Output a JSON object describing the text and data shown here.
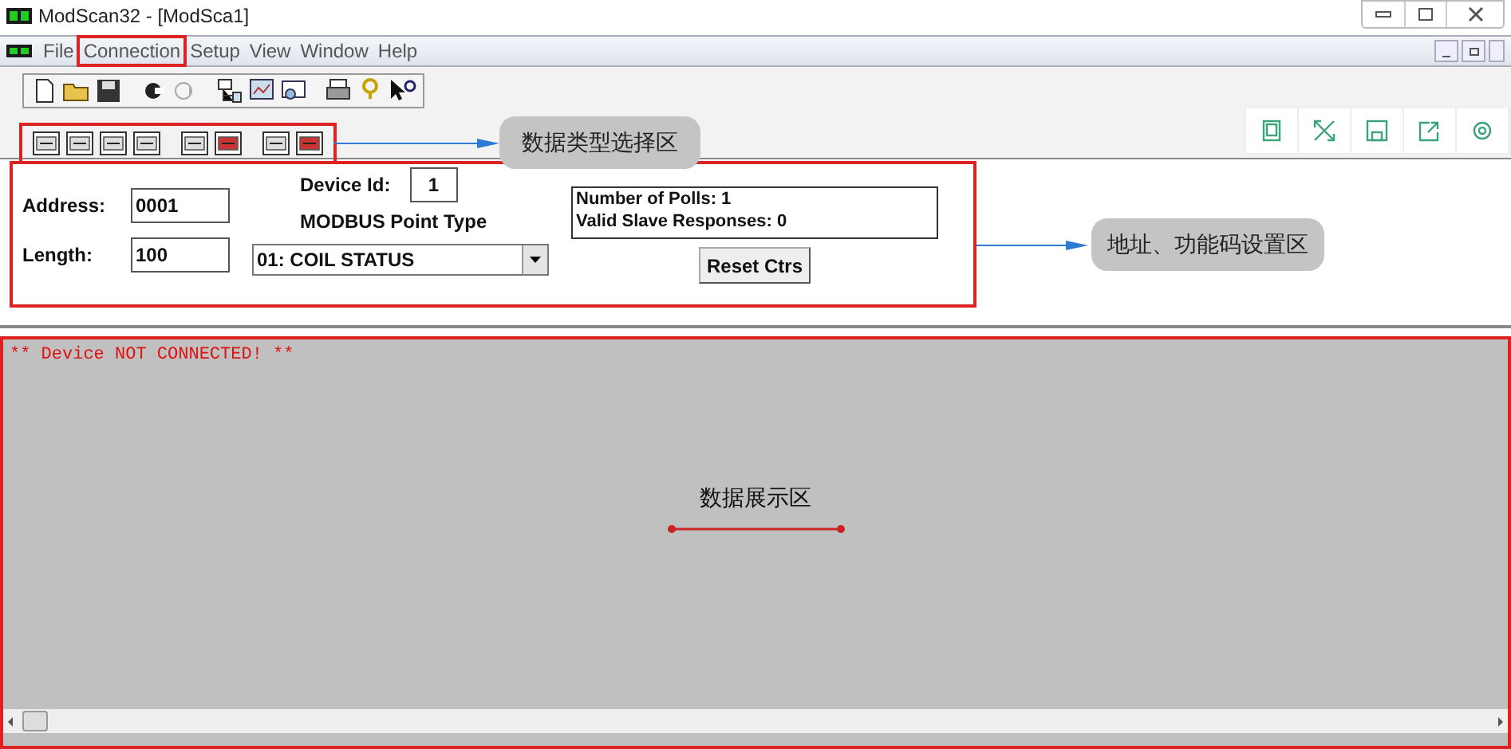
{
  "window": {
    "title": "ModScan32 - [ModSca1]"
  },
  "menu": [
    {
      "label": "File",
      "marked": false
    },
    {
      "label": "Connection",
      "marked": true
    },
    {
      "label": "Setup",
      "marked": false
    },
    {
      "label": "View",
      "marked": false
    },
    {
      "label": "Window",
      "marked": false
    },
    {
      "label": "Help",
      "marked": false
    }
  ],
  "config": {
    "address_label": "Address:",
    "address": "0001",
    "length_label": "Length:",
    "length": "100",
    "device_id_label": "Device Id:",
    "device_id": "1",
    "point_type_label": "MODBUS Point Type",
    "point_type": "01: COIL STATUS",
    "polls": "Number of Polls: 1",
    "responses": "Valid Slave Responses: 0",
    "reset_button": "Reset Ctrs"
  },
  "data_view": {
    "message": "** Device NOT CONNECTED! **"
  },
  "annotations": [
    {
      "text": "数据类型选择区"
    },
    {
      "text": "地址、功能码设置区"
    },
    {
      "text": "数据展示区"
    }
  ]
}
